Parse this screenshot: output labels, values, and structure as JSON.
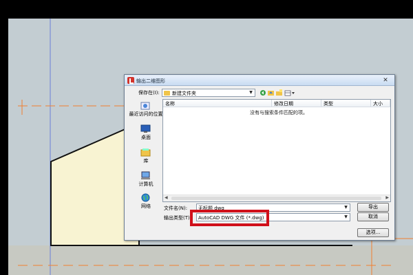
{
  "dialog": {
    "title": "输出二维图形",
    "close_symbol": "✕",
    "save_in": {
      "label": "保存在(I):",
      "value": "新建文件夹"
    },
    "places": [
      {
        "label": "最近访问的位置"
      },
      {
        "label": "桌面"
      },
      {
        "label": "库"
      },
      {
        "label": "计算机"
      },
      {
        "label": "网络"
      }
    ],
    "columns": [
      "名称",
      "修改日期",
      "类型",
      "大小"
    ],
    "empty_message": "没有与搜索条件匹配的项。",
    "file_name": {
      "label": "文件名(N):",
      "value": "无标题 dwg"
    },
    "file_type": {
      "label": "输出类型(T):",
      "value": "AutoCAD DWG 文件 (*.dwg)"
    },
    "buttons": {
      "export": "导出",
      "cancel": "取消",
      "options": "选项..."
    }
  },
  "colors": {
    "highlight": "#d0101a",
    "guide_orange": "#f08030",
    "guide_blue": "#6a7fd8",
    "shape_fill": "#f8f3d2"
  }
}
